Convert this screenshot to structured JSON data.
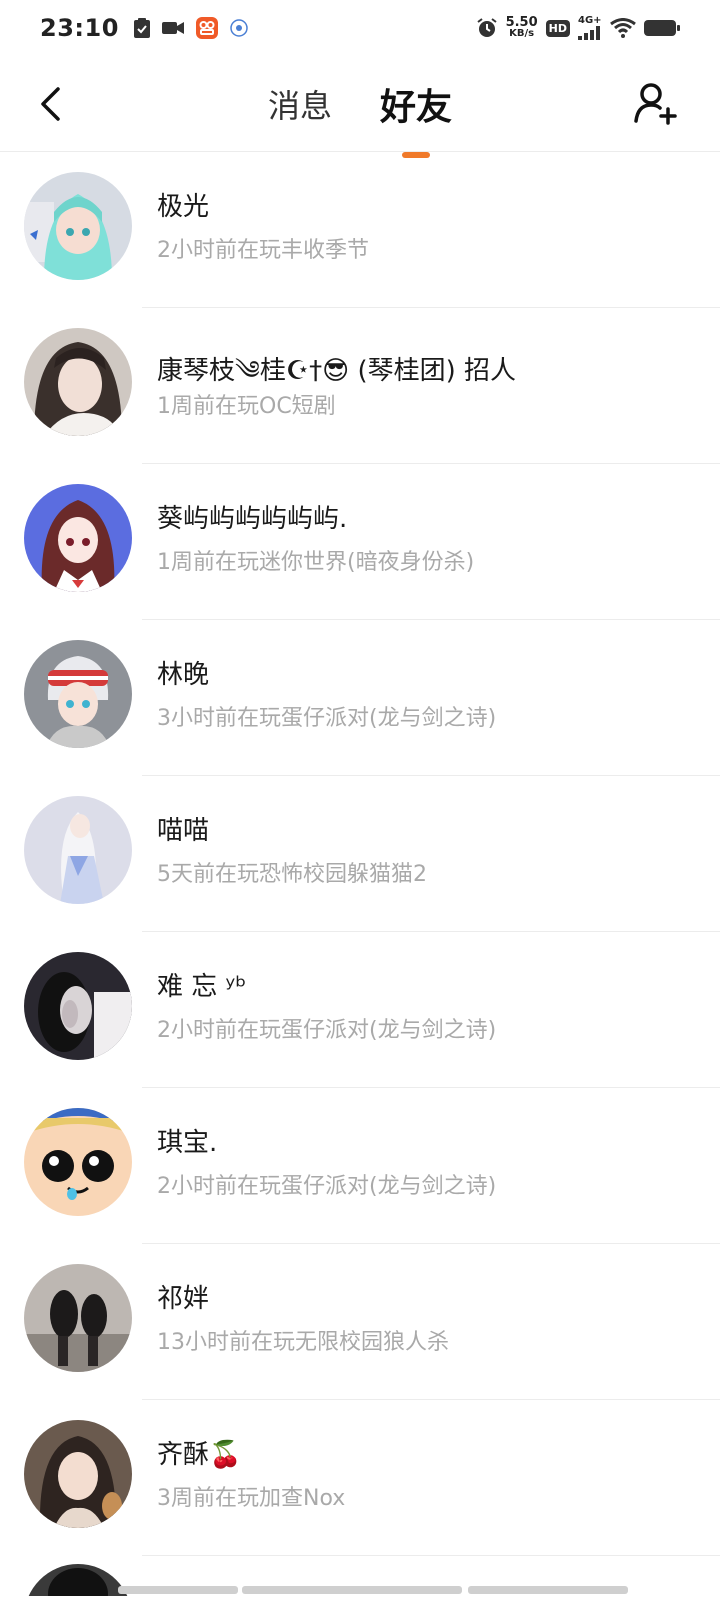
{
  "status_bar": {
    "time": "23:10",
    "net_speed_value": "5.50",
    "net_speed_unit": "KB/s",
    "hd_label": "HD",
    "network_label": "4G+"
  },
  "nav": {
    "tabs": [
      {
        "label": "消息",
        "active": false
      },
      {
        "label": "好友",
        "active": true
      }
    ],
    "accent_color": "#f07a2a"
  },
  "friends": [
    {
      "name": "极光",
      "status": "2小时前在玩丰收季节"
    },
    {
      "name": "康琴枝༄桂☪︎†😎 (琴桂团) 招人",
      "status": "1周前在玩OC短剧"
    },
    {
      "name": "葵屿屿屿屿屿屿.",
      "status": "1周前在玩迷你世界(暗夜身份杀)"
    },
    {
      "name": "林晚",
      "status": "3小时前在玩蛋仔派对(龙与剑之诗)"
    },
    {
      "name": "喵喵",
      "status": "5天前在玩恐怖校园躲猫猫2"
    },
    {
      "name": "难 忘 ʸᵇ",
      "status": "2小时前在玩蛋仔派对(龙与剑之诗)"
    },
    {
      "name": "琪宝.",
      "status": "2小时前在玩蛋仔派对(龙与剑之诗)"
    },
    {
      "name": "祁姅",
      "status": "13小时前在玩无限校园狼人杀"
    },
    {
      "name": "齐酥🍒",
      "status": "3周前在玩加查Nox"
    }
  ]
}
